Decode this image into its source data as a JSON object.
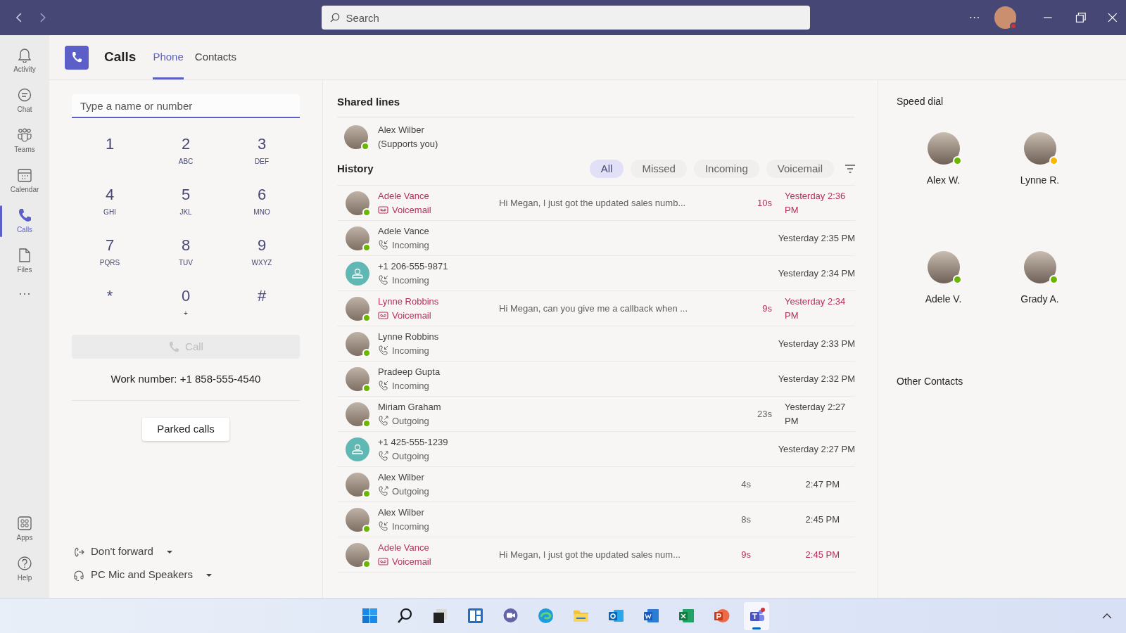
{
  "title_bar": {
    "search": {
      "placeholder": "Search"
    },
    "more": "···"
  },
  "rail": {
    "top": [
      {
        "kind": "bell",
        "label": "Activity",
        "selected": false
      },
      {
        "kind": "chat",
        "label": "Chat",
        "selected": false
      },
      {
        "kind": "teams",
        "label": "Teams",
        "selected": false
      },
      {
        "kind": "calendar",
        "label": "Calendar",
        "selected": false
      },
      {
        "kind": "phone",
        "label": "Calls",
        "selected": true
      },
      {
        "kind": "file",
        "label": "Files",
        "selected": false
      }
    ],
    "more": "···",
    "bottom": [
      {
        "kind": "apps",
        "label": "Apps",
        "selected": false
      },
      {
        "kind": "help",
        "label": "Help",
        "selected": false
      }
    ]
  },
  "header": {
    "title": "Calls",
    "tabs": [
      {
        "label": "Phone",
        "selected": true
      },
      {
        "label": "Contacts",
        "selected": false
      }
    ]
  },
  "dialer": {
    "input": {
      "placeholder": "Type a name or number"
    },
    "keys": [
      {
        "digit": "1"
      },
      {
        "digit": "2",
        "letters": "ABC"
      },
      {
        "digit": "3",
        "letters": "DEF"
      },
      {
        "digit": "4",
        "letters": "GHI"
      },
      {
        "digit": "5",
        "letters": "JKL"
      },
      {
        "digit": "6",
        "letters": "MNO"
      },
      {
        "digit": "7",
        "letters": "PQRS"
      },
      {
        "digit": "8",
        "letters": "TUV"
      },
      {
        "digit": "9",
        "letters": "WXYZ"
      },
      {
        "digit": "*"
      },
      {
        "digit": "0",
        "letters": "+"
      },
      {
        "digit": "#"
      }
    ],
    "call_button": {
      "label": "Call",
      "disabled": true
    },
    "work_number": "Work number: +1 858-555-4540",
    "parked_calls": "Parked calls",
    "dropdowns": [
      {
        "kind": "forward",
        "label": "Don't forward"
      },
      {
        "kind": "device",
        "label": "PC Mic and Speakers"
      }
    ]
  },
  "shared_lines": {
    "title": "Shared lines",
    "items": [
      {
        "name": "Alex Wilber",
        "note": "(Supports you)"
      }
    ]
  },
  "history": {
    "title": "History",
    "filters": [
      {
        "label": "All",
        "selected": true
      },
      {
        "label": "Missed",
        "selected": false
      },
      {
        "label": "Incoming",
        "selected": false
      },
      {
        "label": "Voicemail",
        "selected": false
      }
    ],
    "rows": [
      {
        "avatar": {
          "kind": "photo"
        },
        "name": "Adele Vance",
        "kind": "voicemail",
        "type": "Voicemail",
        "preview": "Hi Megan, I just got the updated sales numb...",
        "duration": "10s",
        "time": "Yesterday 2:36 PM"
      },
      {
        "avatar": {
          "kind": "photo"
        },
        "name": "Adele Vance",
        "kind": "incoming",
        "type": "Incoming",
        "time": "Yesterday 2:35 PM"
      },
      {
        "avatar": {
          "kind": "generic"
        },
        "name": "+1 206-555-9871",
        "kind": "incoming",
        "type": "Incoming",
        "time": "Yesterday 2:34 PM"
      },
      {
        "avatar": {
          "kind": "photo"
        },
        "name": "Lynne Robbins",
        "kind": "voicemail",
        "type": "Voicemail",
        "preview": "Hi Megan, can you give me a callback when ...",
        "duration": "9s",
        "time": "Yesterday 2:34 PM"
      },
      {
        "avatar": {
          "kind": "photo"
        },
        "name": "Lynne Robbins",
        "kind": "incoming",
        "type": "Incoming",
        "time": "Yesterday 2:33 PM"
      },
      {
        "avatar": {
          "kind": "photo"
        },
        "name": "Pradeep Gupta",
        "kind": "incoming",
        "type": "Incoming",
        "time": "Yesterday 2:32 PM"
      },
      {
        "avatar": {
          "kind": "photo"
        },
        "name": "Miriam Graham",
        "kind": "outgoing",
        "type": "Outgoing",
        "duration": "23s",
        "time": "Yesterday 2:27 PM"
      },
      {
        "avatar": {
          "kind": "generic"
        },
        "name": "+1 425-555-1239",
        "kind": "outgoing",
        "type": "Outgoing",
        "time": "Yesterday 2:27 PM"
      },
      {
        "avatar": {
          "kind": "photo"
        },
        "name": "Alex Wilber",
        "kind": "outgoing",
        "type": "Outgoing",
        "duration": "4s",
        "time": "2:47 PM"
      },
      {
        "avatar": {
          "kind": "photo"
        },
        "name": "Alex Wilber",
        "kind": "incoming",
        "type": "Incoming",
        "duration": "8s",
        "time": "2:45 PM"
      },
      {
        "avatar": {
          "kind": "photo"
        },
        "name": "Adele Vance",
        "kind": "voicemail",
        "type": "Voicemail",
        "preview": "Hi Megan, I just got the updated sales num...",
        "duration": "9s",
        "time": "2:45 PM"
      }
    ]
  },
  "speed_dial": {
    "title": "Speed dial",
    "contacts": [
      {
        "name": "Alex W.",
        "color": "#6bb700"
      },
      {
        "name": "Lynne R.",
        "color": "#f8b800"
      },
      {
        "name": "Adele V.",
        "color": "#6bb700"
      },
      {
        "name": "Grady A.",
        "color": "#6bb700"
      }
    ]
  },
  "other_contacts": {
    "title": "Other Contacts"
  },
  "taskbar": [
    {
      "kind": "start",
      "selected": false
    },
    {
      "kind": "search",
      "selected": false
    },
    {
      "kind": "taskview",
      "selected": false
    },
    {
      "kind": "widgets",
      "selected": false
    },
    {
      "kind": "chat",
      "selected": false
    },
    {
      "kind": "browser",
      "selected": false
    },
    {
      "kind": "folder",
      "selected": false
    },
    {
      "kind": "mail",
      "selected": false
    },
    {
      "kind": "word",
      "selected": false
    },
    {
      "kind": "sheet",
      "selected": false
    },
    {
      "kind": "slides",
      "selected": false
    },
    {
      "kind": "teams",
      "selected": true
    }
  ]
}
